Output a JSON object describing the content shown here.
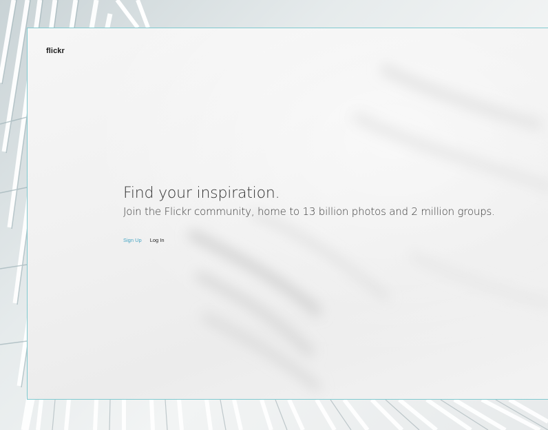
{
  "brand": {
    "logo_text": "flickr"
  },
  "hero": {
    "headline": "Find your inspiration.",
    "subline": "Join the Flickr community, home to 13 billion photos and 2 million groups."
  },
  "actions": {
    "signup_label": "Sign Up",
    "login_label": "Log In"
  },
  "colors": {
    "accent": "#46a5c4",
    "window_border": "#7fc9cf",
    "text_dark": "#333333"
  }
}
